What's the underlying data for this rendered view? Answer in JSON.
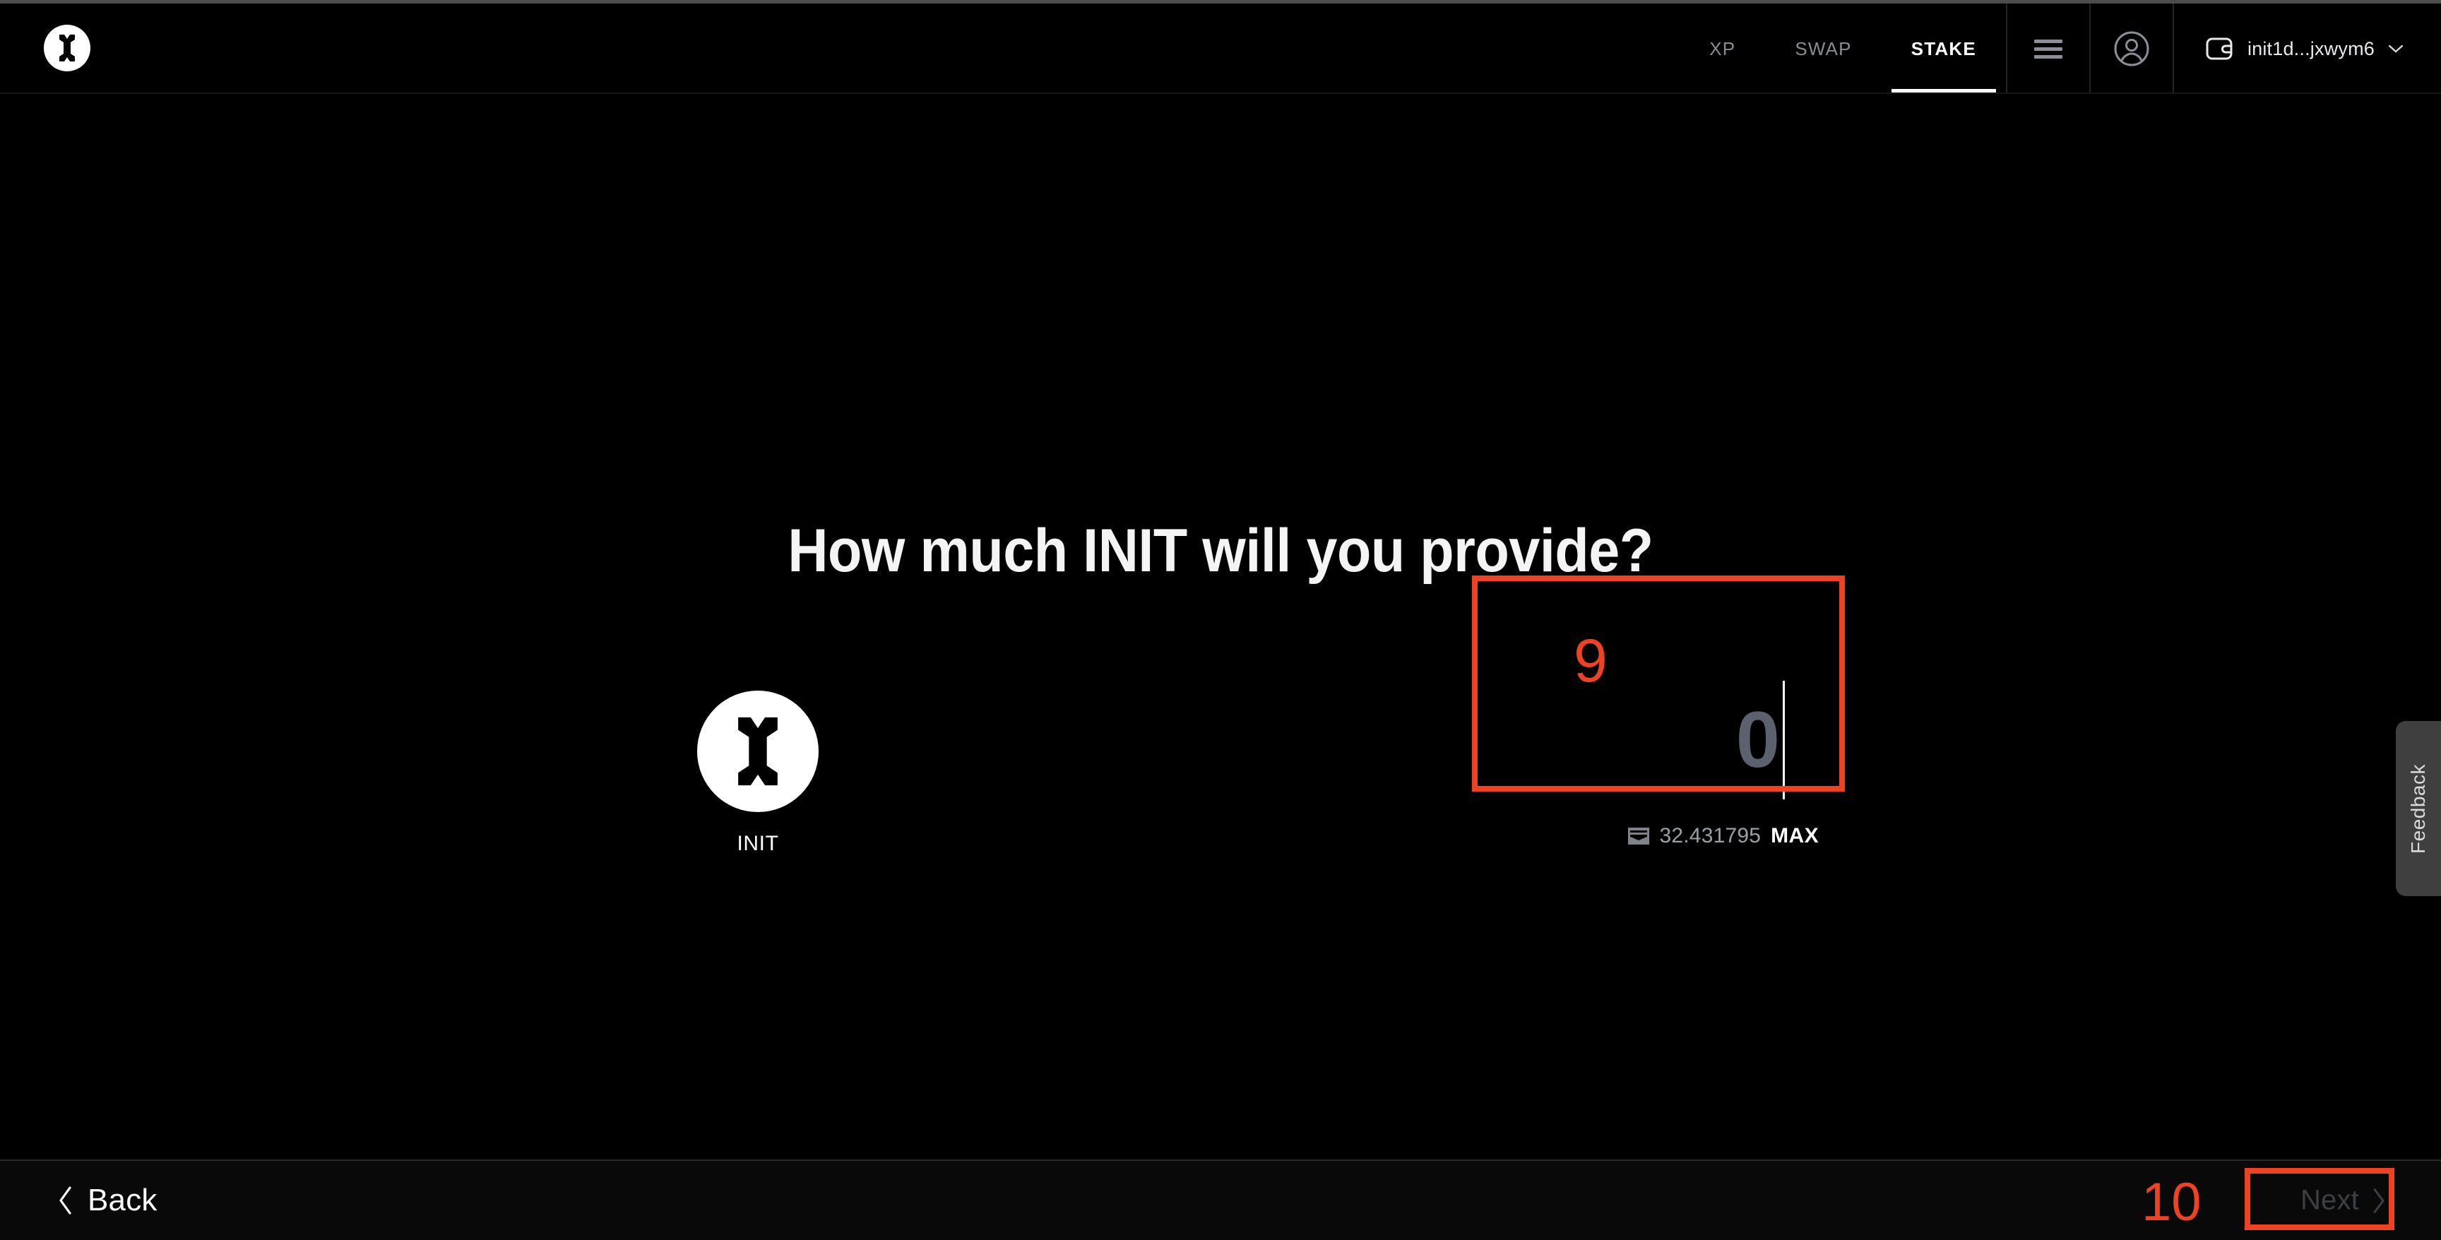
{
  "header": {
    "logo_icon": "init-logo-icon",
    "nav_items": [
      {
        "label": "XP",
        "active": false
      },
      {
        "label": "SWAP",
        "active": false
      },
      {
        "label": "STAKE",
        "active": true
      }
    ],
    "menu_icon": "hamburger-menu-icon",
    "profile_icon": "user-profile-icon",
    "wallet": {
      "icon": "wallet-icon",
      "address": "init1d...jxwym6",
      "chevron_icon": "chevron-down-icon"
    }
  },
  "main": {
    "headline": "How much INIT will you provide?",
    "token": {
      "icon": "init-token-icon",
      "symbol": "INIT"
    },
    "amount_input": {
      "value": "",
      "placeholder": "0",
      "caret_visible": true
    },
    "balance": {
      "icon": "wallet-balance-icon",
      "amount": "32.431795",
      "max_label": "MAX"
    }
  },
  "feedback": {
    "label": "Feedback"
  },
  "footer": {
    "back_label": "Back",
    "back_icon": "chevron-left-icon",
    "next_label": "Next",
    "next_icon": "chevron-right-icon",
    "next_disabled": true
  },
  "annotations": {
    "marker_color": "#ee4323",
    "items": [
      {
        "number": "9",
        "target": "amount-input"
      },
      {
        "number": "10",
        "target": "next-button"
      }
    ],
    "n9": "9",
    "n10": "10"
  },
  "colors": {
    "background": "#000000",
    "footer_background": "#09090a",
    "accent_annotation": "#ee4323",
    "text_primary": "#ffffff",
    "text_muted": "#878c94",
    "placeholder": "#5b626d",
    "disabled": "#3c3f44",
    "feedback_tab": "#3f3f3f"
  }
}
